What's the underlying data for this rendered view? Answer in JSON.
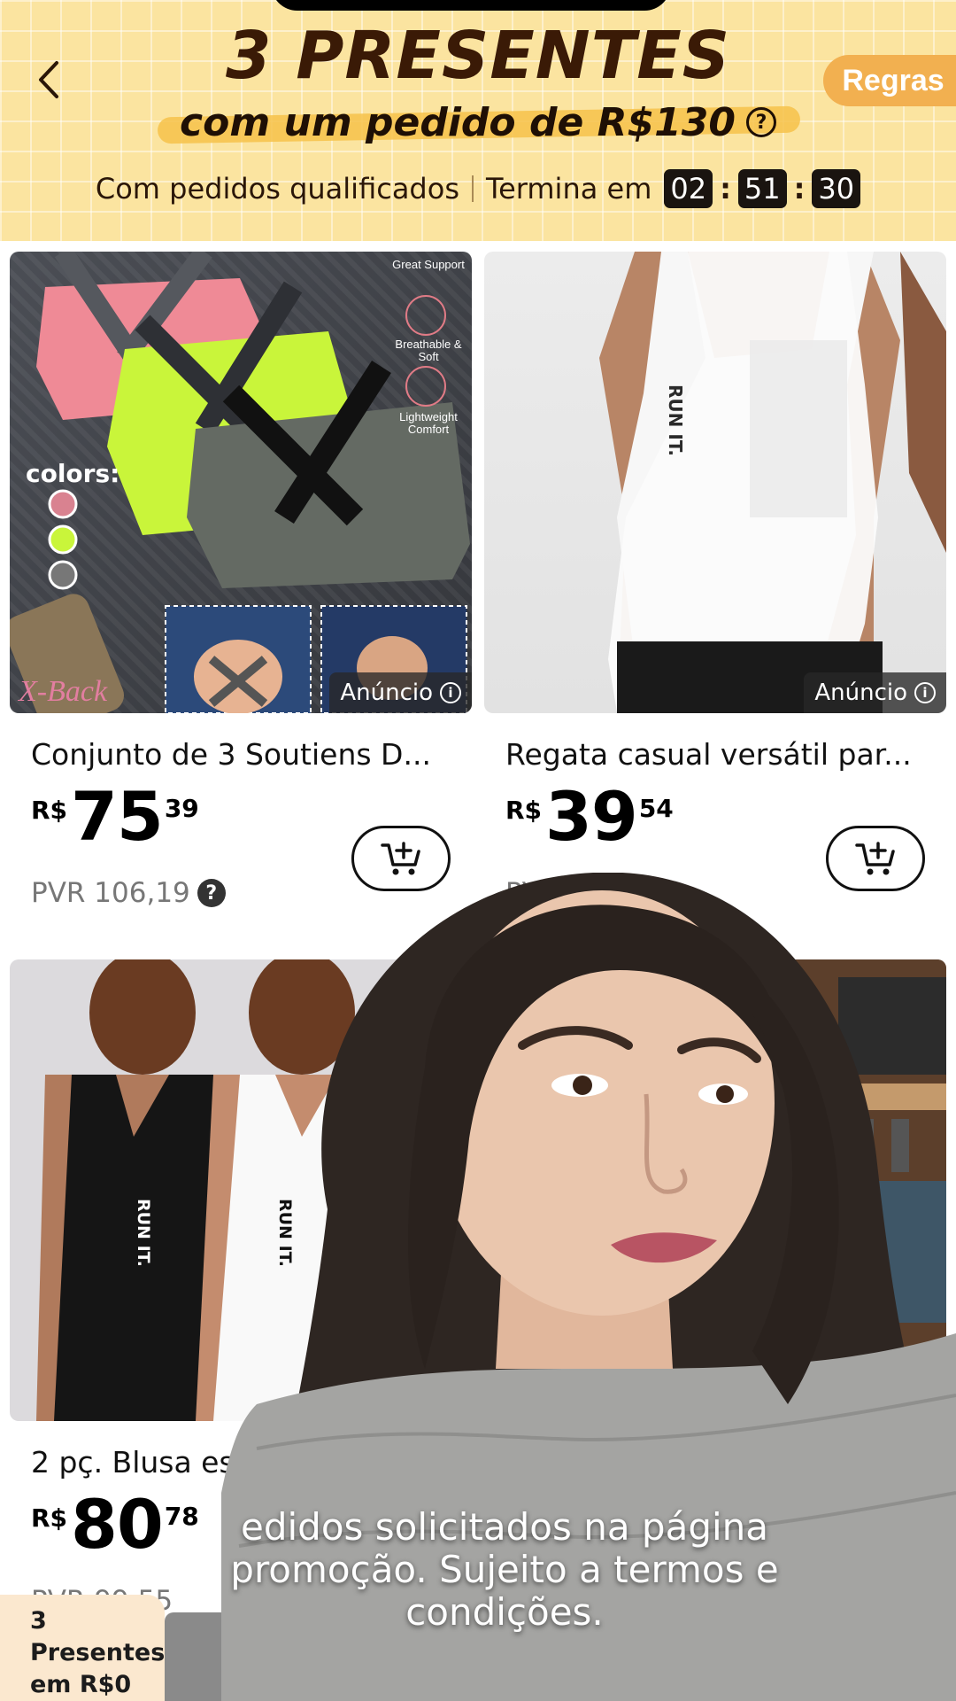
{
  "header": {
    "back_icon": "chevron-left-icon",
    "title": "3 PRESENTES",
    "subtitle": "com um pedido de R$130",
    "rules_label": "Regras",
    "qualified_text": "Com pedidos qualificados",
    "ends_label": "Termina em",
    "timer": {
      "hours": "02",
      "minutes": "51",
      "seconds": "30"
    }
  },
  "products": [
    {
      "name": "Conjunto de 3 Soutiens D...",
      "currency": "R$",
      "price_int": "75",
      "price_dec": "39",
      "pvr": "PVR 106,19",
      "ad_label": "Anúncio",
      "image_text": {
        "colors": "colors:",
        "feat1": "Great Support",
        "feat2": "Breathable & Soft",
        "feat3": "Lightweight Comfort",
        "brand": "X-Back"
      }
    },
    {
      "name": "Regata casual versátil par...",
      "currency": "R$",
      "price_int": "39",
      "price_dec": "54",
      "pvr": "PVR 60,9",
      "ad_label": "Anúncio",
      "image_text": {
        "print": "RUN IT."
      }
    },
    {
      "name": "2 pç. Blusa esporti",
      "currency": "R$",
      "price_int": "80",
      "price_dec": "78",
      "pvr": "PVR 99,55",
      "image_text": {
        "print1": "RUN IT.",
        "print2": "RUN IT."
      }
    }
  ],
  "caption": "edidos solicitados na página promoção. Sujeito a termos e condições.",
  "gift_widget": {
    "line1": "3",
    "line2": "Presentes",
    "line3": "em R$0"
  }
}
